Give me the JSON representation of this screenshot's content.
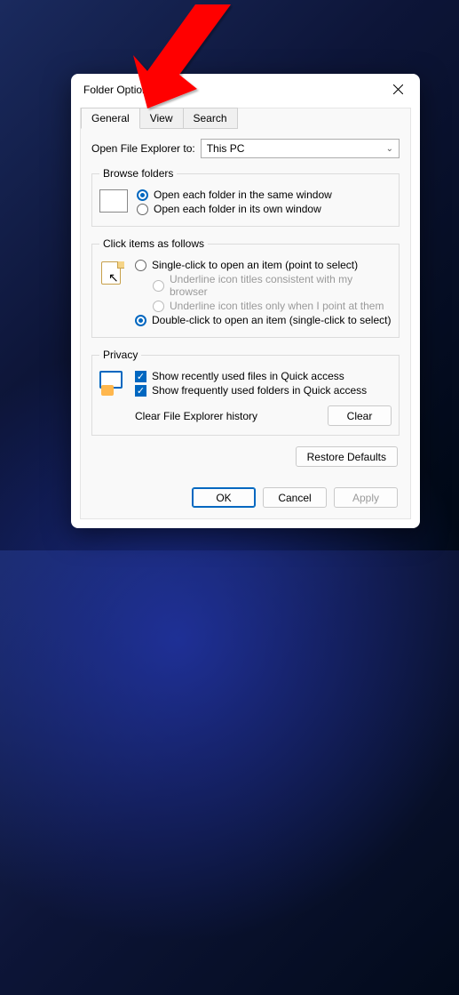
{
  "window": {
    "title": "Folder Options"
  },
  "tabs": {
    "general": "General",
    "view": "View",
    "search": "Search"
  },
  "openExplorer": {
    "label": "Open File Explorer to:",
    "value": "This PC"
  },
  "browseFolders": {
    "legend": "Browse folders",
    "optSame": "Open each folder in the same window",
    "optOwn": "Open each folder in its own window"
  },
  "clickItems": {
    "legend": "Click items as follows",
    "single": "Single-click to open an item (point to select)",
    "underlineBrowser": "Underline icon titles consistent with my browser",
    "underlinePoint": "Underline icon titles only when I point at them",
    "double": "Double-click to open an item (single-click to select)"
  },
  "privacy": {
    "legend": "Privacy",
    "recentFiles": "Show recently used files in Quick access",
    "frequentFolders": "Show frequently used folders in Quick access",
    "clearLabel": "Clear File Explorer history",
    "clearBtn": "Clear"
  },
  "restore": "Restore Defaults",
  "footer": {
    "ok": "OK",
    "cancel": "Cancel",
    "apply": "Apply"
  }
}
